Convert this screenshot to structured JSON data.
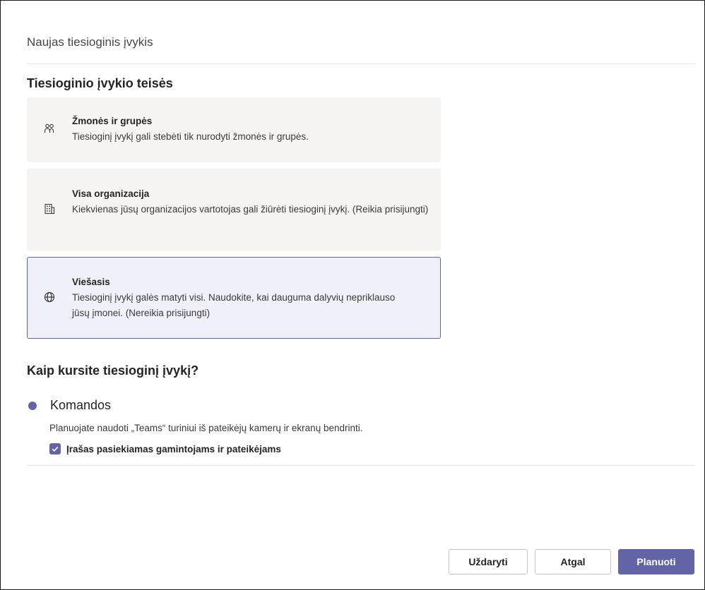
{
  "dialog": {
    "title": "Naujas tiesioginis įvykis"
  },
  "permissions": {
    "heading": "Tiesioginio įvykio teisės",
    "selected": "public",
    "options": [
      {
        "id": "people",
        "icon": "people-icon",
        "title": "Žmonės ir grupės",
        "description": "Tiesioginį įvykį gali stebėti tik nurodyti žmonės ir grupės."
      },
      {
        "id": "org",
        "icon": "building-icon",
        "title": "Visa organizacija",
        "description": "Kiekvienas jūsų organizacijos vartotojas gali žiūrėti tiesioginį įvykį. (Reikia prisijungti)"
      },
      {
        "id": "public",
        "icon": "globe-icon",
        "title": "Viešasis",
        "description": "Tiesioginį įvykį galės matyti visi. Naudokite, kai dauguma dalyvių nepriklauso jūsų įmonei. (Nereikia prisijungti)"
      }
    ]
  },
  "production": {
    "heading": "Kaip kursite tiesioginį įvykį?",
    "option_label": "Komandos",
    "option_description": "Planuojate naudoti „Teams“ turiniui iš pateikėjų kamerų ir ekranų bendrinti.",
    "checkbox_label": "Įrašas pasiekiamas gamintojams ir pateikėjams",
    "checkbox_checked": true
  },
  "buttons": {
    "close": "Uždaryti",
    "back": "Atgal",
    "schedule": "Planuoti"
  },
  "colors": {
    "accent": "#6264a7",
    "card_bg": "#f5f4f3",
    "selected_bg": "#eff0fa"
  }
}
